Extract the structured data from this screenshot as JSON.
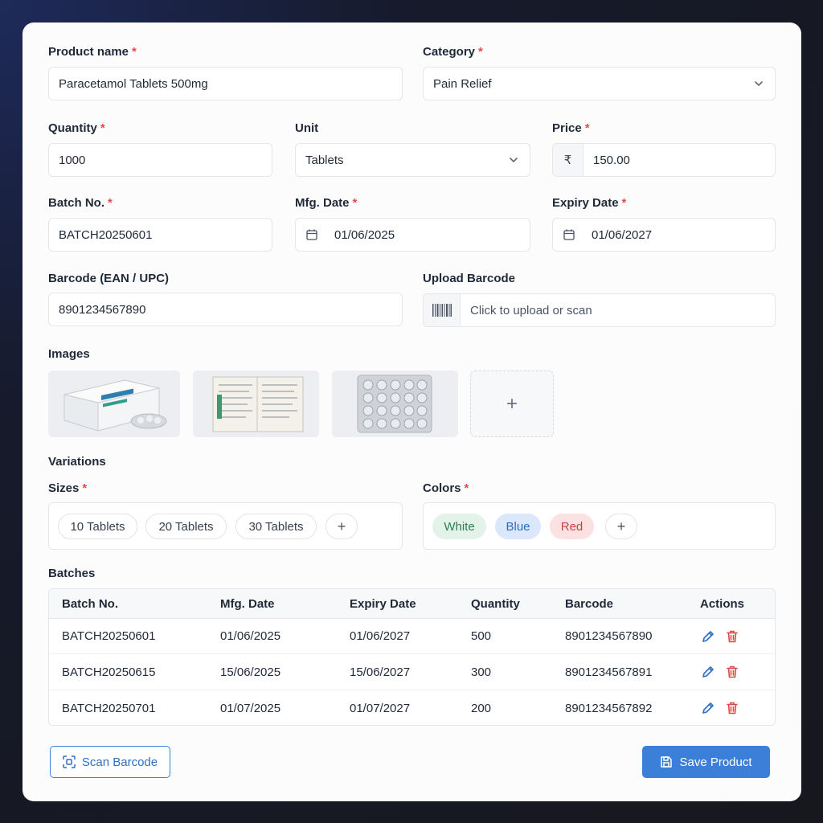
{
  "form": {
    "product_name": {
      "label": "Product name",
      "value": "Paracetamol Tablets 500mg"
    },
    "category": {
      "label": "Category",
      "value": "Pain Relief"
    },
    "quantity": {
      "label": "Quantity",
      "value": "1000"
    },
    "unit": {
      "label": "Unit",
      "value": "Tablets"
    },
    "price": {
      "label": "Price",
      "currency": "₹",
      "value": "150.00"
    },
    "batch_no": {
      "label": "Batch No.",
      "value": "BATCH20250601"
    },
    "mfg_date": {
      "label": "Mfg. Date",
      "value": "01/06/2025"
    },
    "expiry_date": {
      "label": "Expiry Date",
      "value": "01/06/2027"
    },
    "barcode": {
      "label": "Barcode (EAN / UPC)",
      "value": "8901234567890"
    },
    "upload_barcode": {
      "label": "Upload Barcode",
      "placeholder": "Click to upload or scan"
    },
    "required_mark": "*"
  },
  "images": {
    "title": "Images",
    "add_label": "+"
  },
  "variations": {
    "title": "Variations",
    "sizes": {
      "label": "Sizes",
      "items": [
        "10 Tablets",
        "20 Tablets",
        "30 Tablets"
      ],
      "add": "+"
    },
    "colors": {
      "label": "Colors",
      "items": [
        {
          "name": "White",
          "bg": "#e3f3ea",
          "fg": "#2f7d55"
        },
        {
          "name": "Blue",
          "bg": "#dbe8fb",
          "fg": "#2d6bc4"
        },
        {
          "name": "Red",
          "bg": "#fbe1e1",
          "fg": "#c24545"
        }
      ],
      "add": "+"
    }
  },
  "batches": {
    "title": "Batches",
    "columns": [
      "Batch No.",
      "Mfg. Date",
      "Expiry Date",
      "Quantity",
      "Barcode",
      "Actions"
    ],
    "rows": [
      [
        "BATCH20250601",
        "01/06/2025",
        "01/06/2027",
        "500",
        "8901234567890"
      ],
      [
        "BATCH20250615",
        "15/06/2025",
        "15/06/2027",
        "300",
        "8901234567891"
      ],
      [
        "BATCH20250701",
        "01/07/2025",
        "01/07/2027",
        "200",
        "8901234567892"
      ]
    ]
  },
  "actions": {
    "scan_barcode": "Scan Barcode",
    "save_product": "Save Product"
  },
  "colors": {
    "accent": "#3b7fd8",
    "required": "#e5484d",
    "edit_icon": "#2f6fc1",
    "delete_icon": "#e04848"
  }
}
